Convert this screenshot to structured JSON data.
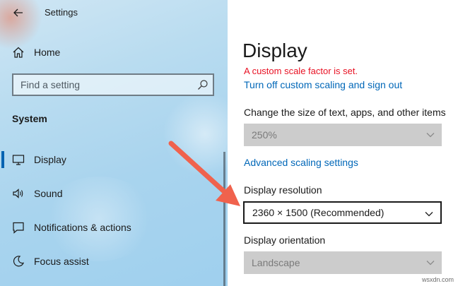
{
  "window": {
    "title": "Settings"
  },
  "sidebar": {
    "home_label": "Home",
    "search_placeholder": "Find a setting",
    "section_label": "System",
    "items": [
      {
        "label": "Display",
        "icon": "monitor-icon",
        "selected": true
      },
      {
        "label": "Sound",
        "icon": "speaker-icon",
        "selected": false
      },
      {
        "label": "Notifications & actions",
        "icon": "notification-icon",
        "selected": false
      },
      {
        "label": "Focus assist",
        "icon": "moon-icon",
        "selected": false
      }
    ]
  },
  "main": {
    "page_title": "Display",
    "warning": "A custom scale factor is set.",
    "turn_off_link": "Turn off custom scaling and sign out",
    "scale_label": "Change the size of text, apps, and other items",
    "scale_value": "250%",
    "advanced_link": "Advanced scaling settings",
    "resolution_label": "Display resolution",
    "resolution_value": "2360 × 1500 (Recommended)",
    "orientation_label": "Display orientation",
    "orientation_value": "Landscape"
  },
  "watermark": "wsxdn.com",
  "colors": {
    "accent": "#0063b1",
    "link": "#0067b8",
    "warning": "#e81123",
    "arrow": "#f0624d"
  }
}
